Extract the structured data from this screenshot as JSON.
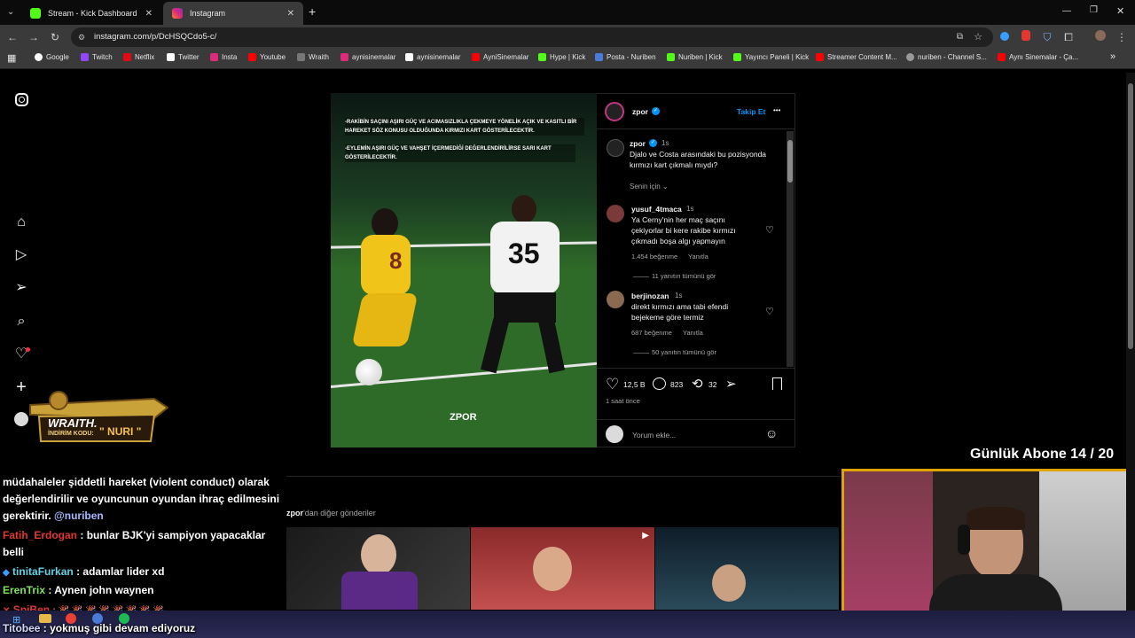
{
  "tabs": [
    {
      "label": "Stream - Kick Dashboard",
      "close": "✕"
    },
    {
      "label": "Instagram",
      "close": "✕"
    }
  ],
  "new_tab": "+",
  "window_controls": [
    "—",
    "❐",
    "✕"
  ],
  "url": "instagram.com/p/DcHSQCdo5-c/",
  "bookmarks": [
    "Google",
    "Twitch",
    "Netflix",
    "Twitter",
    "Insta",
    "Youtube",
    "Wraith",
    "aynisinemalar",
    "aynisinemalar",
    "AyniSinemalar",
    "Hype | Kick",
    "Posta - Nuriben",
    "Nuriben | Kick",
    "Yayıncı Paneli | Kick",
    "Streamer Content M...",
    "nuriben - Channel S...",
    "Aynı Sinemalar - Ça..."
  ],
  "bookmarks_more": "»",
  "sidebar_badge": {
    "title": "WRAITH.",
    "code_label": "İNDİRİM KODU:",
    "code": "\" NURI \""
  },
  "post": {
    "overlay_text_1": "-RAKİBİN SAÇINI AŞIRI GÜÇ VE ACIMASIZLIKLA ÇEKMEYE YÖNELİK AÇIK VE KASITLI BİR HAREKET SÖZ KONUSU OLDUĞUNDA KIRMIZI KART GÖSTERİLECEKTİR.",
    "overlay_text_2": "-EYLEMİN AŞIRI GÜÇ VE VAHŞET İÇERMEDİĞİ DEĞERLENDİRİLİRSE SARI KART GÖSTERİLECEKTİR.",
    "jersey_left": "8",
    "jersey_right": "35",
    "watermark": "ZPOR",
    "author": "zpor",
    "follow": "Takip Et",
    "more": "•••",
    "caption_author": "zpor",
    "caption_time": "1s",
    "caption": "Djalo ve Costa arasındaki bu pozisyonda kırmızı kart çıkmalı mıydı?",
    "sort": "Senin için",
    "comments": [
      {
        "user": "yusuf_4tmaca",
        "time": "1s",
        "text": "Ya Cerny'nin her maç saçını çekiyorlar bi kere rakibe kırmızı çıkmadı boşa algı yapmayın",
        "likes": "1.454 beğenme",
        "reply": "Yanıtla",
        "thread": "11 yanıtın tümünü gör"
      },
      {
        "user": "berjinozan",
        "time": "1s",
        "text": "direkt kırmızı ama tabi efendi bejekeme göre termiz",
        "likes": "687 beğenme",
        "reply": "Yanıtla",
        "thread": "50 yanıtın tümünü gör"
      }
    ],
    "like_count": "12,5 B",
    "comment_count": "823",
    "repost_count": "32",
    "posted": "1 saat önce",
    "comment_placeholder": "Yorum ekle..."
  },
  "more_posts_user": "zpor",
  "more_posts_suffix": "'dan diğer gönderiler",
  "subscriber_goal": "Günlük Abone 14 / 20",
  "chat": [
    {
      "user": "",
      "text": "müdahaleler şiddetli hareket (violent conduct) olarak"
    },
    {
      "user": "",
      "text": "değerlendirilir ve oyuncunun oyundan ihraç edilmesini"
    },
    {
      "user": "",
      "text": "gerektirir.",
      "mention": "@nuriben"
    },
    {
      "user": "Fatih_Erdogan",
      "text": ": bunlar BJK'yi sampiyon yapacaklar"
    },
    {
      "user": "",
      "text": "belli"
    },
    {
      "user": "tinitaFurkan",
      "text": ": adamlar lider xd"
    },
    {
      "user": "ErenTrix",
      "text": ": Aynen john waynen"
    },
    {
      "user": "SpiBen",
      "text": ": 🎉 🎉 🎉 🎉 🎉 🎉 🎉 🎉"
    },
    {
      "user": "Titobee",
      "text": ": yokmuş gibi devam ediyoruz"
    }
  ],
  "colors": {
    "accent_blue": "#0095f6",
    "kick_green": "#53fc18",
    "goal_border": "#e0a400",
    "chat_red": "#e0392f",
    "chat_cyan": "#62d2e6",
    "chat_green": "#7fe35b"
  }
}
